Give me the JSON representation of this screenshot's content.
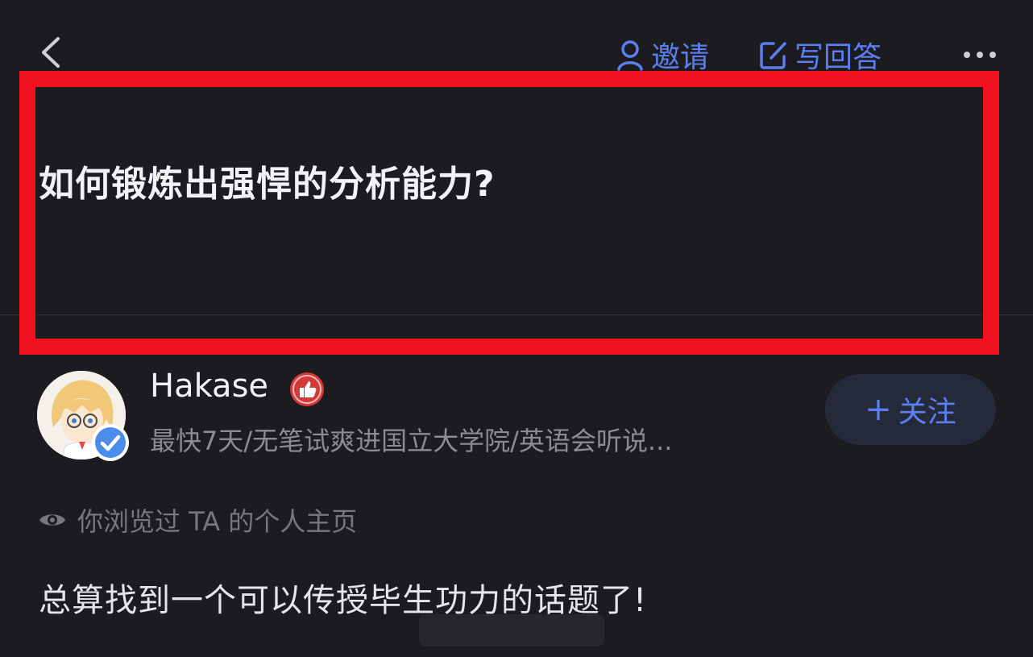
{
  "topbar": {
    "back_icon": "chevron-left-icon",
    "invite_label": "邀请",
    "invite_icon": "person-icon",
    "write_answer_label": "写回答",
    "write_answer_icon": "edit-icon",
    "more_icon": "more-dots-icon"
  },
  "question": {
    "title": "如何锻炼出强悍的分析能力?"
  },
  "author": {
    "name": "Hakase",
    "bio": "最快7天/无笔试爽进国立大学院/英语会听说...",
    "verified": true,
    "follow_label": "关注",
    "follow_plus": "+"
  },
  "viewed_note": "你浏览过 TA 的个人主页",
  "answer_preview": "总算找到一个可以传授毕生功力的话题了!",
  "colors": {
    "background": "#1b1b20",
    "accent": "#5b7ff0",
    "highlight": "#f01020",
    "muted_text": "#8a8b93"
  }
}
